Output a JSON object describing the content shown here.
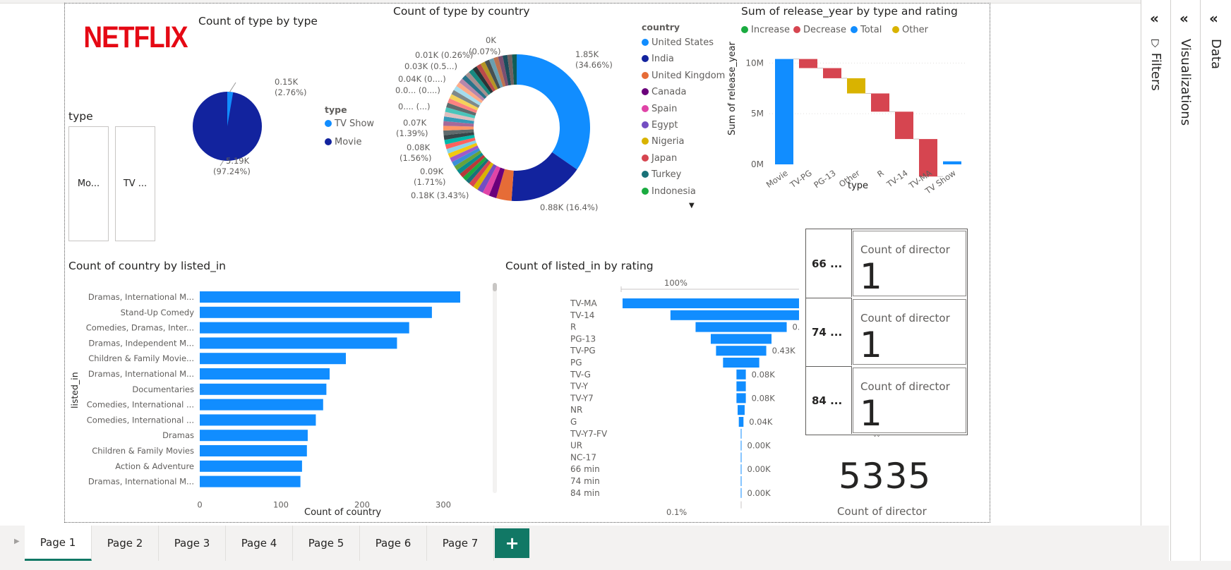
{
  "colors": {
    "accent_blue": "#118DFF",
    "dark_navy": "#12239E",
    "orange": "#E66C37",
    "purple": "#6B007B",
    "pink": "#E044A7",
    "violet": "#744EC2",
    "gold": "#D9B300",
    "red": "#D64550",
    "teal": "#197278",
    "green": "#1AAB40",
    "netflix_red": "#E50914",
    "tab_green": "#117865"
  },
  "logo": {
    "text": "NETFLIX"
  },
  "type_slicer": {
    "title": "type",
    "items": [
      "Mo...",
      "TV ..."
    ]
  },
  "pie_type": {
    "title": "Count of type by type",
    "legend_title": "type",
    "legend": [
      {
        "label": "TV Show",
        "color": "#118DFF"
      },
      {
        "label": "Movie",
        "color": "#12239E"
      }
    ],
    "label_tv_1": "0.15K",
    "label_tv_2": "(2.76%)",
    "label_movie_1": "5.19K",
    "label_movie_2": "(97.24%)"
  },
  "donut": {
    "title": "Count of type by country",
    "legend_title": "country",
    "legend": [
      {
        "label": "United States",
        "color": "#118DFF"
      },
      {
        "label": "India",
        "color": "#12239E"
      },
      {
        "label": "United Kingdom",
        "color": "#E66C37"
      },
      {
        "label": "Canada",
        "color": "#6B007B"
      },
      {
        "label": "Spain",
        "color": "#E044A7"
      },
      {
        "label": "Egypt",
        "color": "#744EC2"
      },
      {
        "label": "Nigeria",
        "color": "#D9B300"
      },
      {
        "label": "Japan",
        "color": "#D64550"
      },
      {
        "label": "Turkey",
        "color": "#197278"
      },
      {
        "label": "Indonesia",
        "color": "#1AAB40"
      }
    ],
    "labels": {
      "us_1": "1.85K",
      "us_2": "(34.66%)",
      "india": "0.88K (16.4%)",
      "uk": "0.18K (3.43%)",
      "ca_1": "0.09K",
      "ca_2": "(1.71%)",
      "sp_1": "0.08K",
      "sp_2": "(1.56%)",
      "eg_1": "0.07K",
      "eg_2": "(1.39%)",
      "l1": "0.... (...)",
      "l2": "0.0... (0....)",
      "l3": "0.04K (0....)",
      "l4": "0.03K (0.5...)",
      "l5": "0.01K (0.26%)",
      "l6_1": "0K",
      "l6_2": "(0.07%)"
    }
  },
  "waterfall": {
    "title": "Sum of release_year by type and rating",
    "legend": [
      {
        "label": "Increase",
        "color": "#1AAB40"
      },
      {
        "label": "Decrease",
        "color": "#D64550"
      },
      {
        "label": "Total",
        "color": "#118DFF"
      },
      {
        "label": "Other",
        "color": "#D9B300"
      }
    ],
    "ylabel": "Sum of release_year",
    "xlabel": "type",
    "yticks": [
      "10M",
      "5M",
      "0M"
    ]
  },
  "card_grid": {
    "rows": [
      {
        "head": "66 ...",
        "label": "Count of director",
        "value": "1"
      },
      {
        "head": "74 ...",
        "label": "Count of director",
        "value": "1"
      },
      {
        "head": "84 ...",
        "label": "Count of director",
        "value": "1"
      }
    ]
  },
  "kpi": {
    "value": "5335",
    "label": "Count of director"
  },
  "bar_listed": {
    "title": "Count of country by listed_in",
    "ylabel": "listed_in",
    "xlabel": "Count of country",
    "xticks": [
      "0",
      "100",
      "200",
      "300"
    ]
  },
  "funnel": {
    "title": "Count of listed_in by rating",
    "top_label": "100%",
    "bottom_label": "0.1%"
  },
  "chart_data": [
    {
      "type": "pie",
      "title": "Count of type by type",
      "categories": [
        "TV Show",
        "Movie"
      ],
      "values": [
        0.15,
        5.19
      ],
      "unit": "K",
      "percent": [
        2.76,
        97.24
      ]
    },
    {
      "type": "pie",
      "variant": "donut",
      "title": "Count of type by country",
      "categories": [
        "United States",
        "India",
        "United Kingdom",
        "Canada",
        "Spain",
        "Egypt",
        "Nigeria",
        "Japan",
        "Turkey",
        "Indonesia"
      ],
      "values": [
        1.85,
        0.88,
        0.18,
        0.09,
        0.08,
        0.07,
        0.06,
        0.06,
        0.05,
        0.05
      ],
      "unit": "K",
      "percent_labels": [
        "34.66%",
        "16.4%",
        "3.43%",
        "1.71%",
        "1.56%",
        "1.39%"
      ]
    },
    {
      "type": "bar",
      "variant": "waterfall",
      "title": "Sum of release_year by type and rating",
      "categories": [
        "Movie",
        "TV-PG",
        "PG-13",
        "Other",
        "R",
        "TV-14",
        "TV-MA",
        "TV Show"
      ],
      "kinds": [
        "total",
        "decrease",
        "decrease",
        "other",
        "decrease",
        "decrease",
        "decrease",
        "total"
      ],
      "values": [
        10.4,
        -0.9,
        -1.0,
        -1.5,
        -1.8,
        -2.7,
        -3.7,
        0.3
      ],
      "unit": "M",
      "xlabel": "type",
      "ylabel": "Sum of release_year",
      "ylim": [
        0,
        11
      ],
      "yticks": [
        "10M",
        "5M",
        "0M"
      ]
    },
    {
      "type": "bar",
      "orientation": "horizontal",
      "title": "Count of country by listed_in",
      "categories": [
        "Dramas, International M...",
        "Stand-Up Comedy",
        "Comedies, Dramas, Inter...",
        "Dramas, Independent M...",
        "Children & Family Movie...",
        "Dramas, International M...",
        "Documentaries",
        "Comedies, International ...",
        "Comedies, International ...",
        "Dramas",
        "Children & Family Movies",
        "Action & Adventure",
        "Dramas, International M..."
      ],
      "values": [
        336,
        286,
        258,
        243,
        180,
        160,
        156,
        152,
        143,
        133,
        132,
        126,
        124
      ],
      "xlabel": "Count of country",
      "ylabel": "listed_in",
      "xlim": [
        0,
        340
      ],
      "xticks": [
        "0",
        "100",
        "200",
        "300"
      ]
    },
    {
      "type": "bar",
      "variant": "funnel",
      "title": "Count of listed_in by rating",
      "categories": [
        "TV-MA",
        "TV-14",
        "R",
        "PG-13",
        "TV-PG",
        "PG",
        "TV-G",
        "TV-Y",
        "TV-Y7",
        "NR",
        "G",
        "TV-Y7-FV",
        "UR",
        "NC-17",
        "66 min",
        "74 min",
        "84 min"
      ],
      "values": [
        2.03,
        1.21,
        0.78,
        0.52,
        0.43,
        0.31,
        0.08,
        0.08,
        0.08,
        0.06,
        0.04,
        0.001,
        0.003,
        0.003,
        0.001,
        0.001,
        0.001
      ],
      "unit": "K",
      "value_labels": [
        "",
        "1.21K",
        "0.78K",
        "",
        "0.43K",
        "",
        "0.08K",
        "",
        "0.08K",
        "",
        "0.04K",
        "",
        "0.00K",
        "",
        "0.00K",
        "",
        "0.00K"
      ]
    }
  ],
  "panes": {
    "filters": "Filters",
    "visualizations": "Visualizations",
    "data": "Data"
  },
  "tabs": [
    "Page 1",
    "Page 2",
    "Page 3",
    "Page 4",
    "Page 5",
    "Page 6",
    "Page 7"
  ],
  "active_tab": "Page 1",
  "add_tab": "+"
}
